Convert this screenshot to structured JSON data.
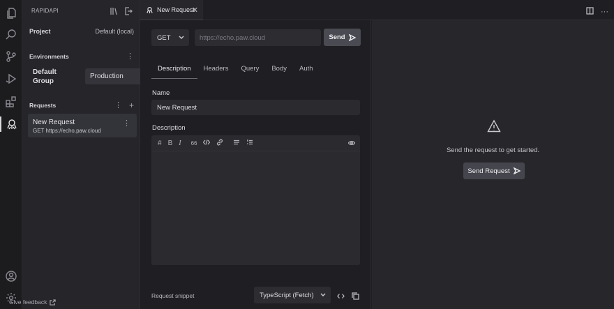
{
  "sidebar": {
    "header": "RAPIDAPI",
    "project_label": "Project",
    "project_value": "Default (local)",
    "environments_label": "Environments",
    "env_group_label": "Default Group",
    "env_selected": "Production",
    "requests_label": "Requests",
    "request": {
      "name": "New Request",
      "url": "GET https://echo.paw.cloud"
    },
    "feedback": "Give feedback"
  },
  "tab": {
    "title": "New Request",
    "close": "✕"
  },
  "editor": {
    "method": "GET",
    "url_placeholder": "https://echo.paw.cloud",
    "send_label": "Send",
    "tabs": [
      "Description",
      "Headers",
      "Query",
      "Body",
      "Auth"
    ],
    "name_label": "Name",
    "name_value": "New Request",
    "description_label": "Description",
    "toolbar": {
      "heading": "#",
      "bold": "B",
      "italic": "I",
      "quote": "66"
    },
    "snippet_label": "Request snippet",
    "snippet_value": "TypeScript (Fetch)"
  },
  "response": {
    "message": "Send the request to get started.",
    "button": "Send Request"
  },
  "icons": {
    "activity": [
      "files-icon",
      "search-icon",
      "source-control-icon",
      "run-debug-icon",
      "extensions-icon",
      "rapidapi-icon",
      "account-icon",
      "settings-icon"
    ]
  }
}
